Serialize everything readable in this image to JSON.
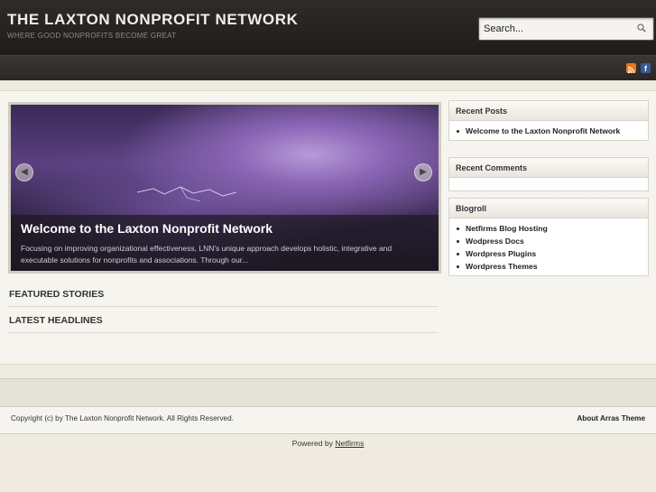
{
  "header": {
    "site_title": "THE LAXTON NONPROFIT NETWORK",
    "tagline": "WHERE GOOD NONPROFITS BECOME GREAT",
    "search_placeholder": "Search..."
  },
  "nav": {
    "icons": [
      "rss-icon",
      "facebook-icon"
    ],
    "facebook_glyph": "f"
  },
  "slider": {
    "title": "Welcome to the Laxton Nonprofit Network",
    "excerpt": "Focusing on improving organizational effectiveness, LNN's unique approach develops holistic, integrative and executable solutions for nonprofits and associations. Through our...",
    "prev_glyph": "◀",
    "next_glyph": "▶"
  },
  "sections": {
    "featured": "FEATURED STORIES",
    "latest": "LATEST HEADLINES"
  },
  "sidebar": {
    "recent_posts": {
      "title": "Recent Posts",
      "items": [
        "Welcome to the Laxton Nonprofit Network"
      ]
    },
    "recent_comments": {
      "title": "Recent Comments",
      "items": []
    },
    "blogroll": {
      "title": "Blogroll",
      "items": [
        "Netfirms Blog Hosting",
        "Wodpress Docs",
        "Wordpress Plugins",
        "Wordpress Themes"
      ]
    }
  },
  "footer": {
    "copyright": "Copyright (c) by The Laxton Nonprofit Network. All Rights Reserved.",
    "about_theme": "About Arras Theme",
    "powered_prefix": "Powered by ",
    "powered_link": "Netfirms"
  },
  "colors": {
    "header_bg": "#2f2b29",
    "page_bg": "#efebe0",
    "rss": "#e9761a",
    "facebook": "#3b5998"
  }
}
